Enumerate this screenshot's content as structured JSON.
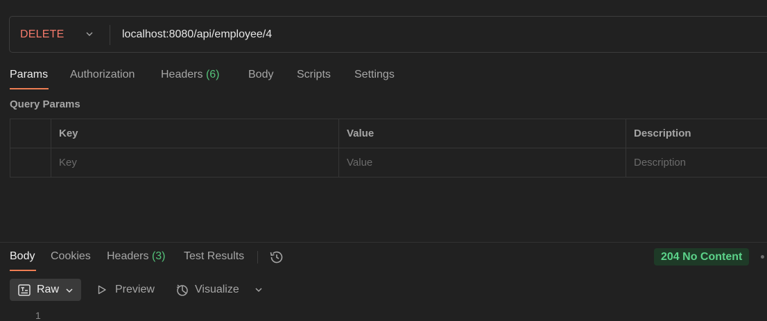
{
  "request": {
    "method": "DELETE",
    "url": "localhost:8080/api/employee/4"
  },
  "request_tabs": [
    {
      "label": "Params",
      "active": true
    },
    {
      "label": "Authorization"
    },
    {
      "label": "Headers",
      "count": "(6)"
    },
    {
      "label": "Body"
    },
    {
      "label": "Scripts"
    },
    {
      "label": "Settings"
    }
  ],
  "query_params": {
    "title": "Query Params",
    "columns": [
      "Key",
      "Value",
      "Description"
    ],
    "placeholders": [
      "Key",
      "Value",
      "Description"
    ]
  },
  "response_tabs": [
    {
      "label": "Body",
      "active": true
    },
    {
      "label": "Cookies"
    },
    {
      "label": "Headers",
      "count": "(3)"
    },
    {
      "label": "Test Results"
    }
  ],
  "status": {
    "code": "204",
    "text": "No Content",
    "color": "#5cd38a"
  },
  "view_modes": {
    "raw": "Raw",
    "preview": "Preview",
    "visualize": "Visualize"
  },
  "editor": {
    "first_line": "1"
  },
  "colors": {
    "accent": "#f07e53",
    "method": "#f47a6b",
    "count": "#55c27a"
  }
}
